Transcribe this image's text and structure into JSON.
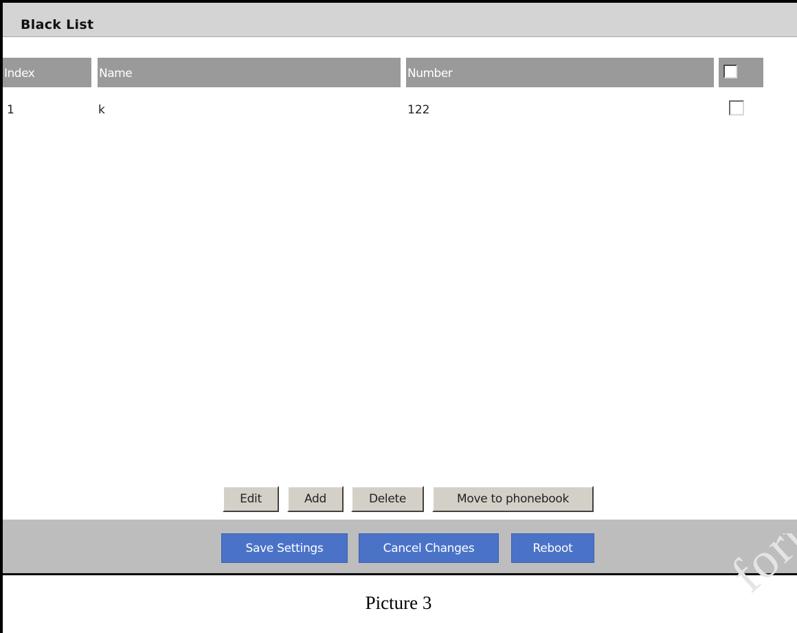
{
  "panel": {
    "title": "Black List"
  },
  "table": {
    "headers": {
      "index": "Index",
      "name": "Name",
      "number": "Number"
    },
    "rows": [
      {
        "index": "1",
        "name": "k",
        "number": "122",
        "checked": false
      }
    ],
    "select_all_checked": false
  },
  "list_buttons": {
    "edit": "Edit",
    "add": "Add",
    "delete": "Delete",
    "move": "Move to phonebook"
  },
  "action_buttons": {
    "save": "Save Settings",
    "cancel": "Cancel Changes",
    "reboot": "Reboot"
  },
  "colors": {
    "title_bar": "#d4d4d4",
    "table_header": "#9a9a9a",
    "action_bar": "#bdbdbd",
    "primary_button": "#4a73c8"
  },
  "caption": "Picture 3",
  "watermark": "forn"
}
